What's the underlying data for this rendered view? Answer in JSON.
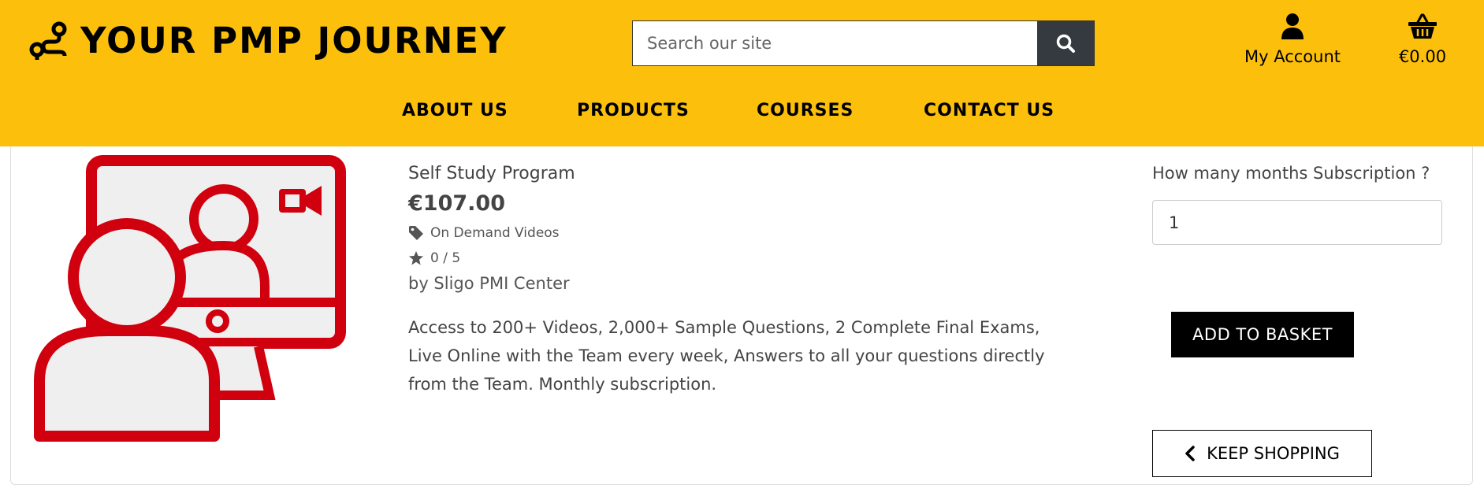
{
  "site": {
    "title": "YOUR PMP JOURNEY",
    "logo_icon": "route-icon"
  },
  "search": {
    "placeholder": "Search our site",
    "button_icon": "search-icon"
  },
  "account": {
    "label": "My Account",
    "icon": "user-icon"
  },
  "basket": {
    "total": "€0.00",
    "icon": "basket-icon"
  },
  "nav": {
    "items": [
      {
        "label": "ABOUT US"
      },
      {
        "label": "PRODUCTS"
      },
      {
        "label": "COURSES"
      },
      {
        "label": "CONTACT US"
      }
    ]
  },
  "product": {
    "image_icon": "online-teaching-icon",
    "name": "Self Study Program",
    "price": "€107.00",
    "category": "On Demand Videos",
    "rating": "0 / 5",
    "seller": "by Sligo PMI Center",
    "description": "Access to 200+ Videos, 2,000+ Sample Questions, 2 Complete Final Exams, Live Online with the Team every week, Answers to all your questions directly from the Team. Monthly subscription."
  },
  "purchase": {
    "quantity_label": "How many months Subscription ?",
    "quantity_value": "1",
    "add_label": "ADD TO BASKET",
    "keep_label": "KEEP SHOPPING"
  },
  "colors": {
    "header_bg": "#fcc00c",
    "product_red": "#d0000e",
    "dark_button": "#343a40"
  }
}
